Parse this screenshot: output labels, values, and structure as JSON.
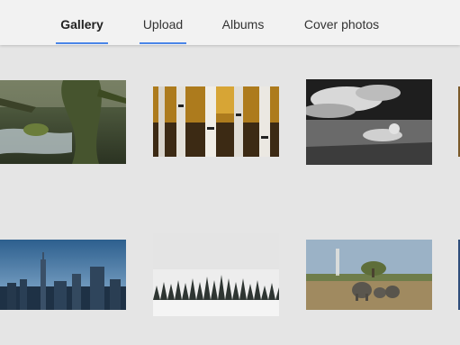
{
  "tabs": [
    {
      "label": "Gallery",
      "active": true,
      "underlined": true
    },
    {
      "label": "Upload",
      "active": false,
      "underlined": true
    },
    {
      "label": "Albums",
      "active": false,
      "underlined": false
    },
    {
      "label": "Cover photos",
      "active": false,
      "underlined": false
    }
  ],
  "accent_color": "#4a86e8",
  "gallery": {
    "photos": [
      {
        "subject": "mossy-forest-stream"
      },
      {
        "subject": "birch-trees-autumn"
      },
      {
        "subject": "lion-resting-black-and-white"
      },
      {
        "subject": "city-skyline-dusk"
      },
      {
        "subject": "snowy-pine-forest"
      },
      {
        "subject": "elephants-savanna"
      }
    ]
  }
}
